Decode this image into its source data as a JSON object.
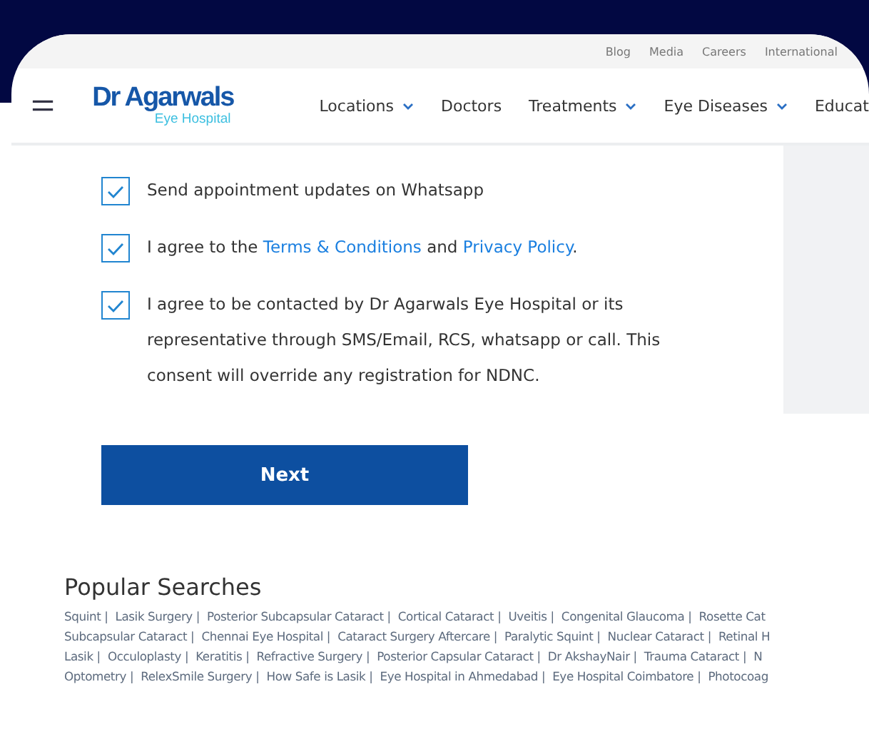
{
  "top_links": [
    "Blog",
    "Media",
    "Careers",
    "International"
  ],
  "logo": {
    "name": "Dr Agarwals",
    "sub": "Eye Hospital"
  },
  "nav": [
    {
      "label": "Locations",
      "dropdown": true
    },
    {
      "label": "Doctors",
      "dropdown": false
    },
    {
      "label": "Treatments",
      "dropdown": true
    },
    {
      "label": "Eye Diseases",
      "dropdown": true
    },
    {
      "label": "Educat",
      "dropdown": false
    }
  ],
  "consents": [
    {
      "text": "Send appointment updates on Whatsapp",
      "checked": true
    },
    {
      "parts": [
        {
          "kind": "text",
          "text": "I agree to the "
        },
        {
          "kind": "link",
          "text": "Terms & Conditions"
        },
        {
          "kind": "text",
          "text": " and "
        },
        {
          "kind": "link",
          "text": "Privacy Policy"
        },
        {
          "kind": "text",
          "text": "."
        }
      ],
      "checked": true
    },
    {
      "text": "I agree to be contacted by Dr Agarwals Eye Hospital or its representative through SMS/Email, RCS, whatsapp or call. This consent will override any registration for NDNC.",
      "checked": true
    }
  ],
  "next_button": "Next",
  "popular": {
    "title": "Popular Searches",
    "links": [
      "Squint |",
      "Lasik Surgery |",
      "Posterior Subcapsular Cataract |",
      "Cortical Cataract |",
      "Uveitis |",
      "Congenital Glaucoma |",
      "Rosette Cat",
      "Subcapsular Cataract |",
      "Chennai Eye Hospital |",
      "Cataract Surgery Aftercare |",
      "Paralytic Squint |",
      "Nuclear Cataract |",
      "Retinal H",
      "Lasik |",
      "Occuloplasty |",
      "Keratitis |",
      "Refractive Surgery |",
      "Posterior Capsular Cataract |",
      "Dr AkshayNair |",
      "Trauma Cataract |",
      "N",
      "Optometry |",
      "RelexSmile Surgery |",
      "How Safe is Lasik |",
      "Eye Hospital in Ahmedabad |",
      "Eye Hospital Coimbatore |",
      "Photocoag"
    ]
  }
}
